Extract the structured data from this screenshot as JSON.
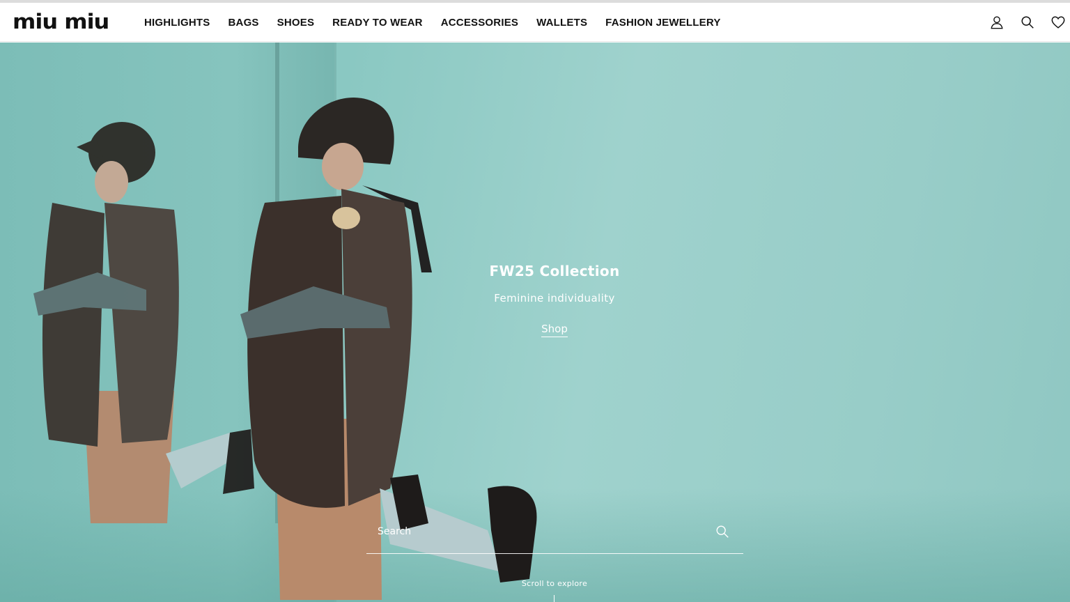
{
  "brand": {
    "logo_text": "miu miu"
  },
  "nav": {
    "items": [
      {
        "label": "HIGHLIGHTS"
      },
      {
        "label": "BAGS"
      },
      {
        "label": "SHOES"
      },
      {
        "label": "READY TO WEAR"
      },
      {
        "label": "ACCESSORIES"
      },
      {
        "label": "WALLETS"
      },
      {
        "label": "FASHION JEWELLERY"
      }
    ]
  },
  "header_icons": [
    "account-icon",
    "search-icon",
    "wishlist-heart-icon"
  ],
  "hero": {
    "title": "FW25 Collection",
    "subtitle": "Feminine individuality",
    "cta_label": "Shop",
    "background_color": "#8fc9c3"
  },
  "search": {
    "placeholder": "Search",
    "value": ""
  },
  "scroll_hint": "Scroll to explore"
}
